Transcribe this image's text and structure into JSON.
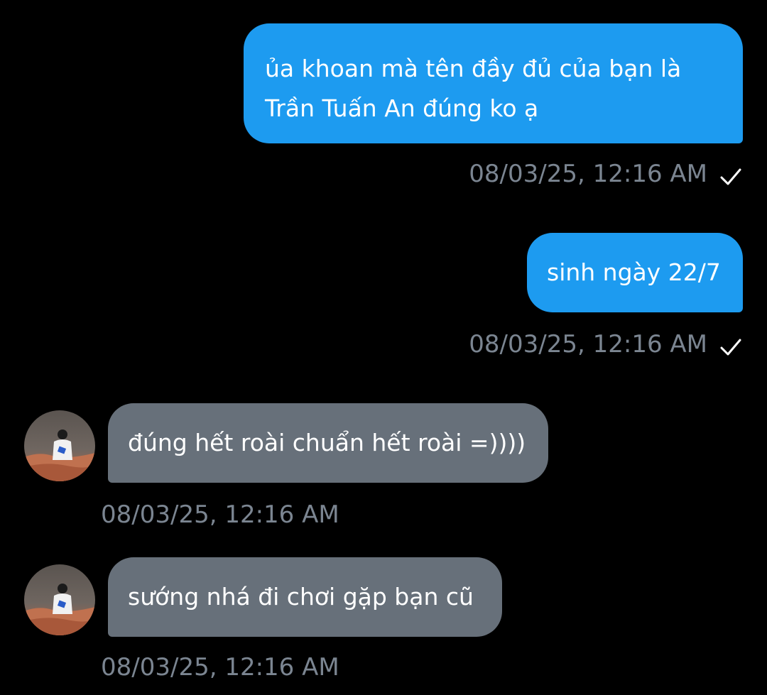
{
  "colors": {
    "background": "#000000",
    "sent_bubble": "#1d9bf0",
    "received_bubble": "#67707a",
    "timestamp_text": "#7b8591",
    "message_text": "#ffffff"
  },
  "messages": [
    {
      "direction": "sent",
      "text": "ủa khoan mà tên đầy đủ của bạn là\nTrần Tuấn An đúng ko ạ",
      "timestamp": "08/03/25, 12:16 AM",
      "status_icon": "check-icon"
    },
    {
      "direction": "sent",
      "text": "sinh ngày 22/7",
      "timestamp": "08/03/25, 12:16 AM",
      "status_icon": "check-icon"
    },
    {
      "direction": "received",
      "text": "đúng hết roài chuẩn hết roài =))))",
      "timestamp": "08/03/25, 12:16 AM",
      "avatar_icon": "contact-avatar"
    },
    {
      "direction": "received",
      "text": "sướng nhá đi chơi gặp bạn cũ",
      "timestamp": "08/03/25, 12:16 AM",
      "avatar_icon": "contact-avatar"
    }
  ]
}
